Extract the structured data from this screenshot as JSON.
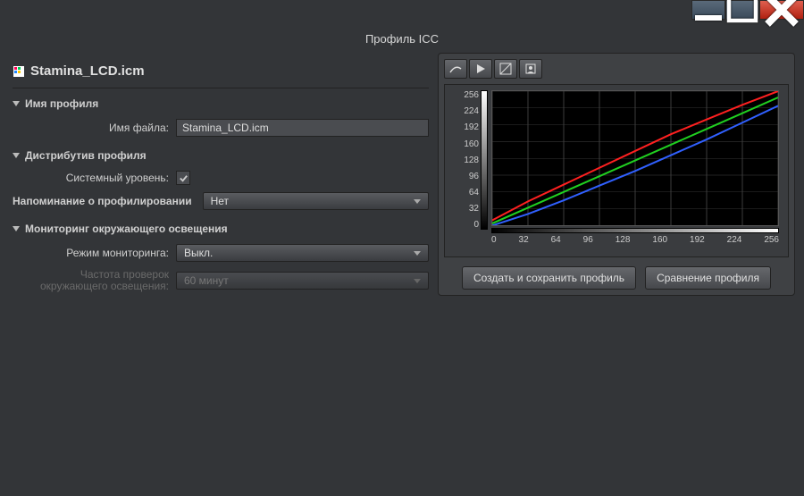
{
  "window": {
    "title": "Профиль ICC"
  },
  "file": {
    "name": "Stamina_LCD.icm"
  },
  "sections": {
    "profileName": {
      "title": "Имя профиля",
      "filenameLabel": "Имя файла:",
      "filenameValue": "Stamina_LCD.icm"
    },
    "distribution": {
      "title": "Дистрибутив профиля",
      "systemLabel": "Системный уровень:",
      "systemChecked": true,
      "reminderLabel": "Напоминание о профилировании",
      "reminderValue": "Нет"
    },
    "monitoring": {
      "title": "Мониторинг окружающего освещения",
      "modeLabel": "Режим мониторинга:",
      "modeValue": "Выкл.",
      "freqLabel": "Частота проверок окружающего освещения:",
      "freqValue": "60 минут"
    }
  },
  "buttons": {
    "save": "Создать и сохранить профиль",
    "compare": "Сравнение профиля"
  },
  "chart_data": {
    "type": "line",
    "xlabel": "",
    "ylabel": "",
    "xlim": [
      0,
      256
    ],
    "ylim": [
      0,
      256
    ],
    "x_ticks": [
      0,
      32,
      64,
      96,
      128,
      160,
      192,
      224,
      256
    ],
    "y_ticks": [
      0,
      32,
      64,
      96,
      128,
      160,
      192,
      224,
      256
    ],
    "x": [
      0,
      32,
      64,
      96,
      128,
      160,
      192,
      224,
      256
    ],
    "series": [
      {
        "name": "red",
        "color": "#ff2020",
        "values": [
          10,
          46,
          78,
          110,
          142,
          174,
          202,
          230,
          256
        ]
      },
      {
        "name": "green",
        "color": "#20d020",
        "values": [
          4,
          34,
          64,
          94,
          124,
          154,
          184,
          214,
          244
        ]
      },
      {
        "name": "blue",
        "color": "#3060ff",
        "values": [
          0,
          22,
          48,
          76,
          104,
          134,
          164,
          196,
          228
        ]
      }
    ]
  }
}
